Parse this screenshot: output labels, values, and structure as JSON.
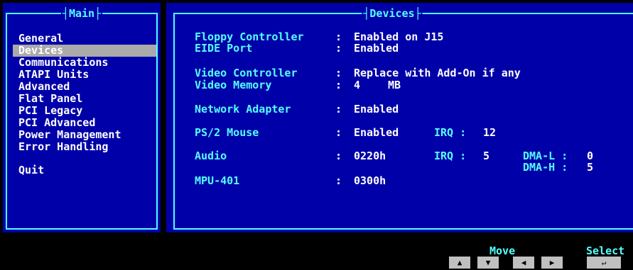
{
  "main_panel": {
    "title": "Main",
    "items": [
      "General",
      "Devices",
      "Communications",
      "ATAPI Units",
      "Advanced",
      "Flat Panel",
      "PCI Legacy",
      "PCI Advanced",
      "Power Management",
      "Error Handling"
    ],
    "selected": "Devices",
    "quit_label": "Quit"
  },
  "devices_panel": {
    "title": "Devices",
    "separator": ":",
    "settings": {
      "floppy_controller": {
        "label": "Floppy Controller",
        "value": "Enabled on J15"
      },
      "eide_port": {
        "label": "EIDE Port",
        "value": "Enabled"
      },
      "video_controller": {
        "label": "Video Controller",
        "value": "Replace with Add-On if any"
      },
      "video_memory": {
        "label": "Video Memory",
        "value": "4",
        "unit": "MB"
      },
      "network_adapter": {
        "label": "Network Adapter",
        "value": "Enabled"
      },
      "ps2_mouse": {
        "label": "PS/2 Mouse",
        "value": "Enabled",
        "irq_label": "IRQ :",
        "irq_value": "12"
      },
      "audio": {
        "label": "Audio",
        "value": "0220h",
        "irq_label": "IRQ :",
        "irq_value": "5",
        "dma_l_label": "DMA-L :",
        "dma_l_value": "0",
        "dma_h_label": "DMA-H :",
        "dma_h_value": "5"
      },
      "mpu401": {
        "label": "MPU-401",
        "value": "0300h"
      }
    }
  },
  "footer": {
    "move_label": "Move",
    "select_label": "Select",
    "keys": {
      "up": "▲",
      "down": "▼",
      "left": "◀",
      "right": "▶",
      "enter": "↵"
    }
  },
  "colors": {
    "panel_bg": "#0000a8",
    "frame": "#55ffff",
    "label": "#55ffff",
    "value": "#ffffff",
    "selection": "#aaaaaa"
  }
}
